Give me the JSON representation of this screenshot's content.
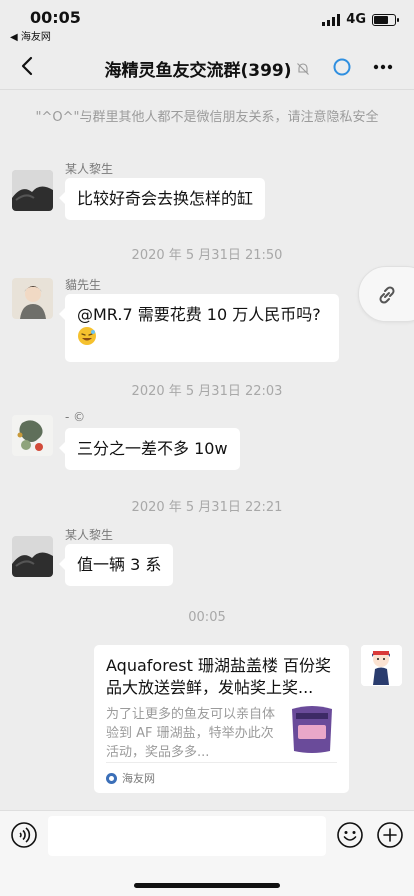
{
  "status_bar": {
    "time": "00:05",
    "back_app": "◀ 海友网",
    "network": "4G",
    "battery_level": 0.7
  },
  "nav": {
    "title": "海精灵鱼友交流群(399)",
    "icons": [
      "back-chevron-icon",
      "mute-bell-icon",
      "circle-icon",
      "more-dots-icon"
    ]
  },
  "chat": {
    "notice": "\"^O^\"与群里其他人都不是微信朋友关系，请注意隐私安全",
    "messages": [
      {
        "sender": "某人黎生",
        "text": "比较好奇会去换怎样的缸"
      },
      {
        "timestamp": "2020 年 5 月31日 21:50"
      },
      {
        "sender": "貓先生",
        "text": "@MR.7 需要花费 10 万人民币吗?"
      },
      {
        "timestamp": "2020 年 5 月31日 22:03"
      },
      {
        "sender": "- ©",
        "text": "三分之一差不多 10w"
      },
      {
        "timestamp": "2020 年 5 月31日 22:21"
      },
      {
        "sender": "某人黎生",
        "text": "值一辆 3 系"
      },
      {
        "timestamp": "00:05"
      }
    ],
    "link_card": {
      "title": "Aquaforest 珊湖盐盖楼 百份奖品大放送尝鲜，发帖奖上奖...",
      "description": "为了让更多的鱼友可以亲自体验到 AF 珊湖盐，特举办此次活动，奖品多多...",
      "source": "海友网"
    }
  },
  "input_bar": {
    "placeholder": "",
    "icons": [
      "voice-icon",
      "emoji-icon",
      "plus-icon"
    ]
  },
  "colors": {
    "background": "#ededed",
    "bubble": "#ffffff",
    "timestamp": "#a8a8a8"
  }
}
